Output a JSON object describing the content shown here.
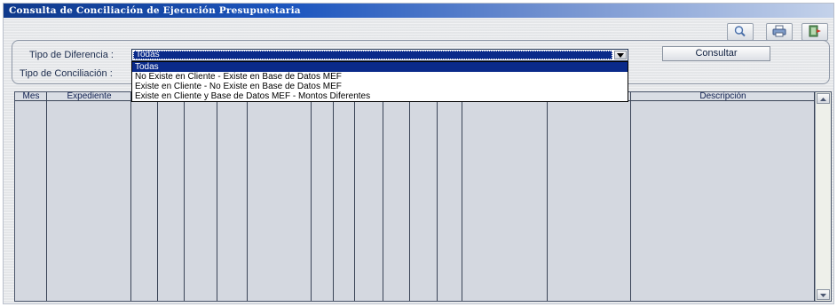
{
  "window": {
    "title": "Consulta de Conciliación de Ejecución Presupuestaria"
  },
  "toolbar": {
    "icons": [
      "search-icon",
      "print-icon",
      "exit-icon"
    ]
  },
  "filters": {
    "tipo_diferencia_label": "Tipo de Diferencia :",
    "tipo_conciliacion_label": "Tipo de Conciliación :",
    "tipo_diferencia_value": "Todas",
    "options": [
      "Todas",
      "No Existe en Cliente - Existe en Base de Datos MEF",
      "Existe en Cliente - No Existe en Base de Datos MEF",
      "Existe en Cliente y Base de Datos MEF - Montos Diferentes"
    ],
    "consultar_label": "Consultar"
  },
  "grid": {
    "headers": {
      "mes": "Mes",
      "expediente": "Expediente",
      "descripcion": "Descripción"
    }
  }
}
